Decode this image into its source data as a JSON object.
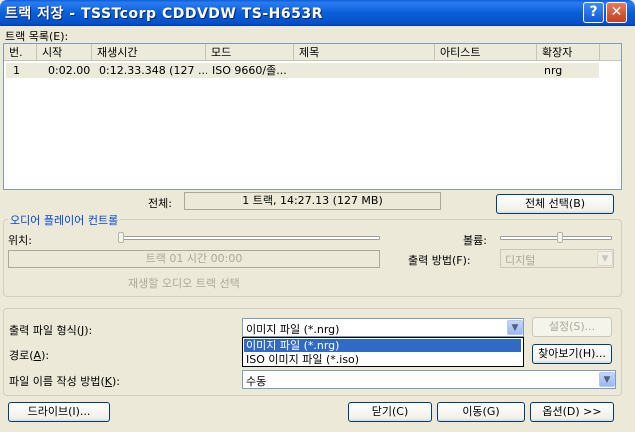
{
  "window": {
    "title": "트랙 저장 - TSSTcorp CDDVDW TS-H653R",
    "help_glyph": "?",
    "close_glyph": "✕"
  },
  "track_list": {
    "label": "트랙 목록(E):",
    "columns": [
      "번.",
      "시작",
      "재생시간",
      "모드",
      "제목",
      "아티스트",
      "확장자"
    ],
    "rows": [
      {
        "num": "1",
        "start": "0:02.00",
        "duration": "0:12.33.348 (127 ...",
        "mode": "ISO 9660/졸...",
        "title": "",
        "artist": "",
        "ext": "nrg"
      }
    ]
  },
  "total": {
    "label": "전체:",
    "value": "1 트랙,   14:27.13 (127 MB)",
    "select_all": "전체 선택(B)"
  },
  "audio": {
    "group_title": "오디어 플레이어 컨트롤",
    "position_label": "위치:",
    "volume_label": "볼륨:",
    "position_level": 0,
    "volume_level": 0.55,
    "track_time": "트랙 01 시간 00:00",
    "hint": "재생할 오디오 트랙 선택",
    "output_method_label": "출력 방법(F):",
    "output_method_value": "디지털"
  },
  "output": {
    "format_label": "출력 파일 형식(J):",
    "format_value": "이미지 파일 (*.nrg)",
    "settings_button": "설정(S)...",
    "dropdown_options": [
      "이미지 파일 (*.nrg)",
      "ISO 이미지 파일 (*.iso)"
    ],
    "path_label": "경로(A):",
    "browse_button": "찾아보기(H)...",
    "naming_label": "파일 이름 작성 방법(K):",
    "naming_value": "수동"
  },
  "buttons": {
    "drive": "드라이브(I)...",
    "close": "닫기(C)",
    "move": "이동(G)",
    "options": "옵션(D) >>"
  }
}
